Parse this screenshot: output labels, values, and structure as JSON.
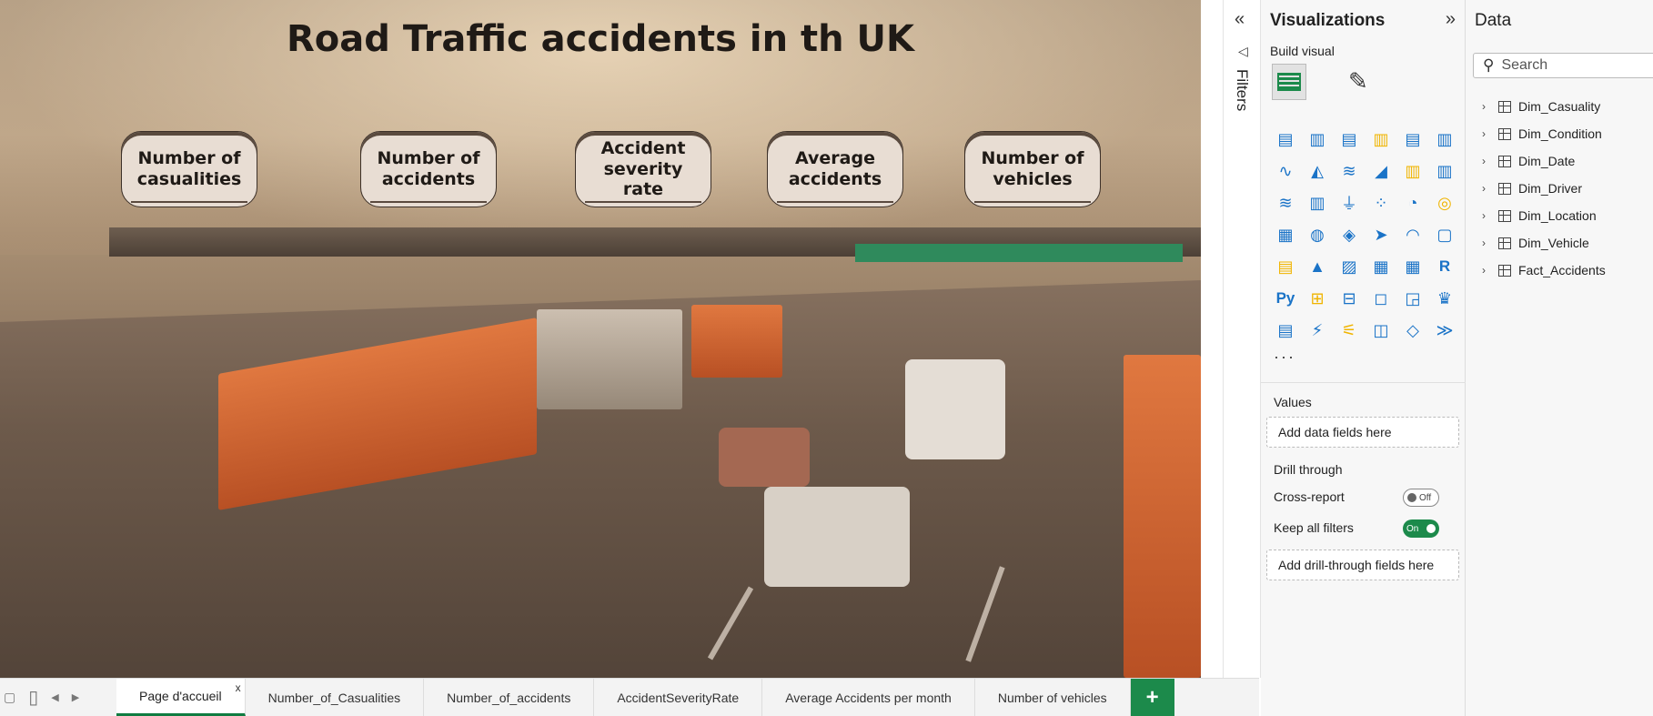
{
  "report": {
    "title": "Road Traffic accidents in th UK",
    "kpis": [
      {
        "label": "Number of casualities"
      },
      {
        "label": "Number of accidents"
      },
      {
        "label": "Accident severity rate"
      },
      {
        "label": "Average accidents"
      },
      {
        "label": "Number of vehicles"
      }
    ]
  },
  "tabs": {
    "items": [
      {
        "label": "Page d'accueil",
        "close": "x"
      },
      {
        "label": "Number_of_Casualities"
      },
      {
        "label": "Number_of_accidents"
      },
      {
        "label": "AccidentSeverityRate"
      },
      {
        "label": "Average Accidents per month"
      },
      {
        "label": "Number of vehicles"
      }
    ],
    "add": "+"
  },
  "filters": {
    "label": "Filters"
  },
  "visualizations": {
    "title": "Visualizations",
    "build_visual": "Build visual",
    "more": "···",
    "values_label": "Values",
    "values_placeholder": "Add data fields here",
    "drill_through": "Drill through",
    "cross_report": "Cross-report",
    "cross_report_state": "Off",
    "keep_all_filters": "Keep all filters",
    "keep_all_filters_state": "On",
    "drill_placeholder": "Add drill-through fields here",
    "icons": [
      "stacked-bar-icon",
      "stacked-column-icon",
      "clustered-bar-icon",
      "clustered-column-icon",
      "100-bar-icon",
      "100-column-icon",
      "line-chart-icon",
      "area-chart-icon",
      "stacked-area-icon",
      "ribbon-icon",
      "line-clustered-column-icon",
      "line-stacked-column-icon",
      "waterfall-icon",
      "column-icon",
      "funnel-icon",
      "scatter-icon",
      "pie-icon",
      "donut-icon",
      "treemap-icon",
      "map-icon",
      "filled-map-icon",
      "azure-map-icon",
      "gauge-icon",
      "card-icon",
      "multirow-card-icon",
      "kpi-icon",
      "slicer-icon",
      "table-icon",
      "matrix-icon",
      "r-visual-icon",
      "python-visual-icon",
      "key-influencers-icon",
      "decomposition-tree-icon",
      "qa-icon",
      "smart-narrative-icon",
      "goals-icon",
      "paginated-report-icon",
      "power-automate-icon",
      "power-apps-icon",
      "metrics-icon",
      "diamond-icon",
      "chevron-icon"
    ],
    "icon_glyphs": [
      "▤",
      "▥",
      "▤",
      "▥",
      "▤",
      "▥",
      "∿",
      "◭",
      "≋",
      "◢",
      "▥",
      "▥",
      "≋",
      "▥",
      "⏚",
      "⁘",
      "◔",
      "◎",
      "▦",
      "◍",
      "◈",
      "➤",
      "◠",
      "▢",
      "▤",
      "▲",
      "▨",
      "▦",
      "▦",
      "R",
      "Py",
      "⊞",
      "⊟",
      "◻",
      "◲",
      "♛",
      "▤",
      "⚡",
      "⚟",
      "◫",
      "◇",
      "≫"
    ]
  },
  "data": {
    "title": "Data",
    "search_placeholder": "Search",
    "tables": [
      "Dim_Casuality",
      "Dim_Condition",
      "Dim_Date",
      "Dim_Driver",
      "Dim_Location",
      "Dim_Vehicle",
      "Fact_Accidents"
    ]
  },
  "colors": {
    "accent": "#1c8a4b",
    "kpi_bg": "#e8ddd3",
    "icon_blue": "#1a73c7",
    "icon_yellow": "#f0b400"
  }
}
